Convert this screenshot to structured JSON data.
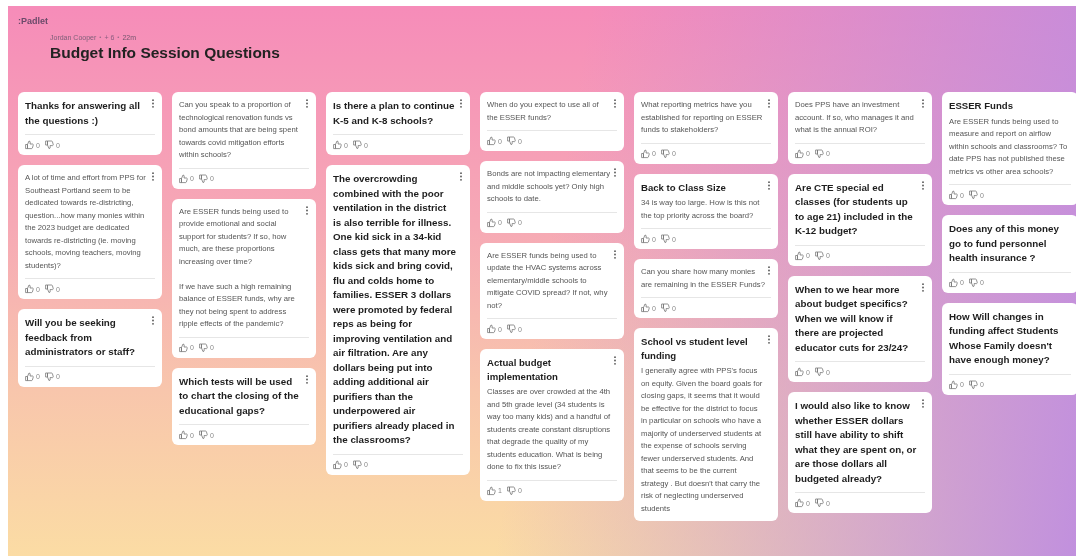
{
  "app": {
    "logo": ":Padlet"
  },
  "header": {
    "byline": [
      {
        "kind": "author",
        "text": "Jordan Cooper"
      },
      {
        "kind": "dot",
        "text": "•"
      },
      {
        "kind": "contributors",
        "text": "+ 6"
      },
      {
        "kind": "dot",
        "text": "•"
      },
      {
        "kind": "age",
        "text": "22m"
      }
    ],
    "title": "Budget Info Session Questions"
  },
  "columns": [
    {
      "cards": [
        {
          "title": "Thanks for answering all the questions :)",
          "likes": "0",
          "dislikes": "0",
          "menu": true
        },
        {
          "body": "A lot of time and effort from PPS for Southeast Portland seem to be dedicated towards re-districting, question...how many monies within the 2023 budget are dedicated towards re-districting (ie. moving schools, moving teachers, moving students)?",
          "likes": "0",
          "dislikes": "0",
          "menu": true
        },
        {
          "title": "Will you be seeking feedback from administrators or staff?",
          "likes": "0",
          "dislikes": "0",
          "menu": true
        }
      ]
    },
    {
      "cards": [
        {
          "body": "Can you speak to a proportion of technological renovation funds vs bond amounts that are being spent towards covid mitigation efforts within schools?",
          "likes": "0",
          "dislikes": "0",
          "menu": true
        },
        {
          "body": "Are ESSER funds being used to provide emotional and social support for students? If so, how much, are these proportions increasing over time?\n\nIf we have such a high remaining balance of ESSER funds, why are they not being spent to address ripple effects of the pandemic?",
          "likes": "0",
          "dislikes": "0",
          "menu": true
        },
        {
          "title": "Which tests will be used to chart the closing of the educational gaps?",
          "likes": "0",
          "dislikes": "0",
          "menu": true
        }
      ]
    },
    {
      "cards": [
        {
          "title": "Is there a plan to continue K-5 and K-8 schools?",
          "likes": "0",
          "dislikes": "0",
          "menu": true
        },
        {
          "title": "The overcrowding combined with the poor ventilation in the district is also terrible for illness. One kid sick in a 34-kid class gets that many more kids sick and bring covid, flu and colds home to families. ESSER 3 dollars were promoted by federal reps as being for improving ventilation and air filtration. Are any dollars being put into adding additional air purifiers than the underpowered air purifiers already placed in the classrooms?",
          "likes": "0",
          "dislikes": "0",
          "menu": true
        }
      ]
    },
    {
      "cards": [
        {
          "body": "When do you expect to use all of the ESSER funds?",
          "likes": "0",
          "dislikes": "0",
          "menu": true
        },
        {
          "body": "Bonds are not impacting elementary and middle schools yet? Only high schools to date.",
          "likes": "0",
          "dislikes": "0",
          "menu": true
        },
        {
          "body": "Are ESSER funds being used to update the HVAC systems across elementary/middle schools to mitigate COVID spread? If not, why not?",
          "likes": "0",
          "dislikes": "0",
          "menu": true
        },
        {
          "title": "Actual budget implementation",
          "body": "Classes are over crowded at the 4th and 5th grade level (34 students is way too many kids) and a handful of students create constant disruptions that degrade the quality of my students education. What is being done to fix this issue?",
          "likes": "1",
          "dislikes": "0",
          "menu": true
        }
      ]
    },
    {
      "cards": [
        {
          "body": "What reporting metrics have you established for reporting on ESSER funds to stakeholders?",
          "likes": "0",
          "dislikes": "0",
          "menu": true
        },
        {
          "title": "Back to Class Size",
          "body": "34 is way too large. How is this not the top priority across the board?",
          "likes": "0",
          "dislikes": "0",
          "menu": true
        },
        {
          "body": "Can you share how many monies are remaining in the ESSER Funds?",
          "likes": "0",
          "dislikes": "0",
          "menu": true
        },
        {
          "title": "School vs student level funding",
          "body": "I generally agree with PPS's focus on equity. Given the board goals for closing gaps, it seems that it would be effective for the district to focus in particular on schools who have a majority of underserved students at the expense of schools serving fewer underserved students. And that seems to be the current strategy . But doesn't that carry the risk of neglecting underserved students",
          "menu": true
        }
      ]
    },
    {
      "cards": [
        {
          "body": "Does PPS have an investment account. If so, who manages it and what is the annual ROI?",
          "likes": "0",
          "dislikes": "0",
          "menu": true
        },
        {
          "title": "Are CTE special ed classes (for students up to age 21) included in the K-12 budget?",
          "likes": "0",
          "dislikes": "0",
          "menu": true
        },
        {
          "title": "When to we hear more about budget specifics? When we will know if there are projected educator cuts for 23/24?",
          "likes": "0",
          "dislikes": "0",
          "menu": true
        },
        {
          "title": "I would also like to know whether ESSER dollars still have ability to shift what they are spent on, or are those dollars all budgeted already?",
          "likes": "0",
          "dislikes": "0",
          "menu": true
        }
      ]
    },
    {
      "cards": [
        {
          "title": "ESSER Funds",
          "body": "Are ESSER funds being used to measure and report on airflow within schools and classrooms? To date PPS has not published these metrics vs other area schools?",
          "likes": "0",
          "dislikes": "0",
          "menu": false
        },
        {
          "title": "Does any of this money go to fund personnel health insurance ?",
          "likes": "0",
          "dislikes": "0",
          "menu": false
        },
        {
          "title": "How Will changes in funding affect Students Whose Family doesn't have enough money?",
          "likes": "0",
          "dislikes": "0",
          "menu": false
        }
      ]
    }
  ]
}
